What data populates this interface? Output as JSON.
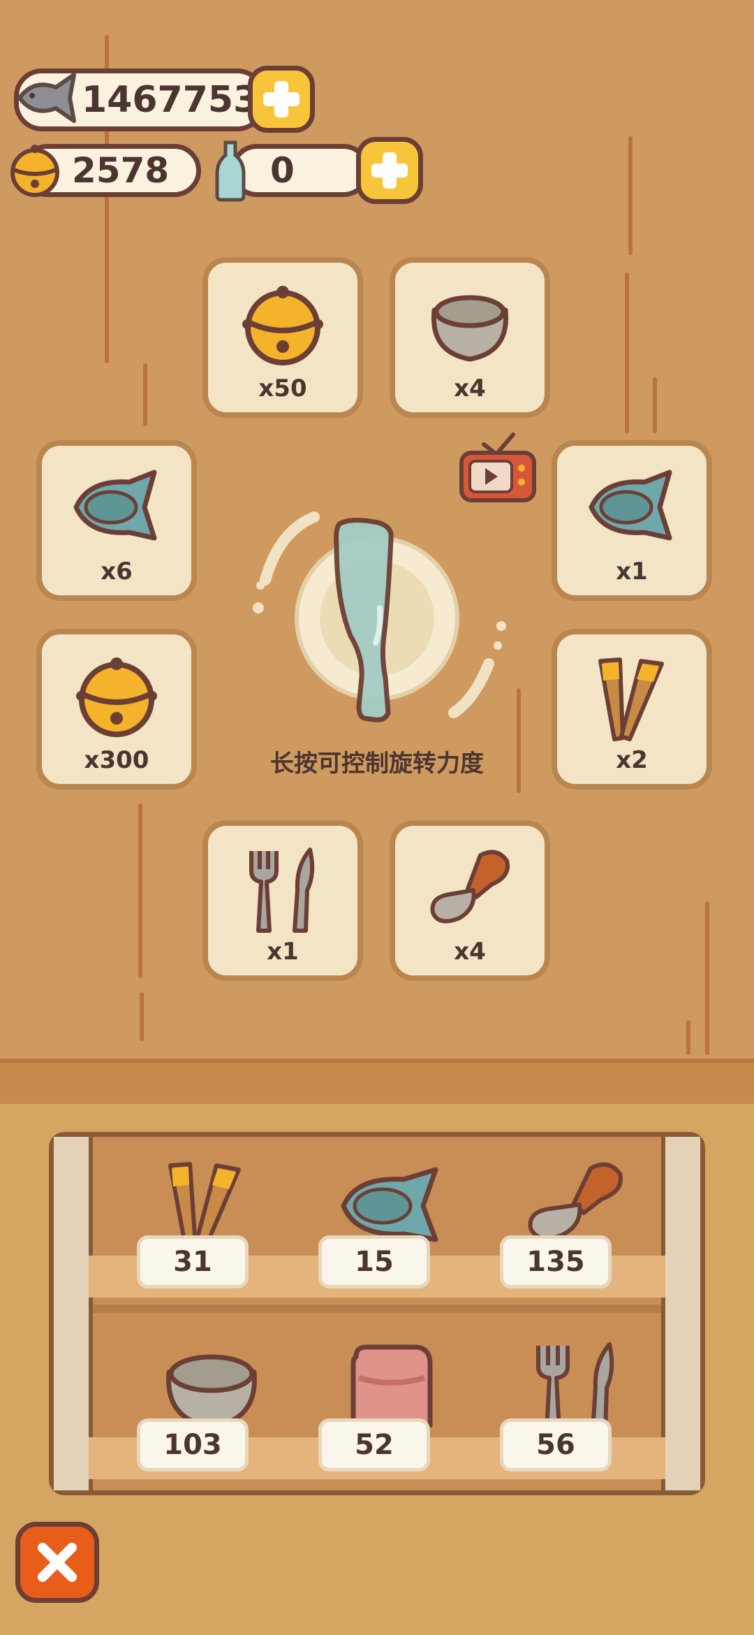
{
  "currency": {
    "fish": "1467753",
    "bells": "2578",
    "bottles": "0"
  },
  "rewards": [
    {
      "item": "bell-icon",
      "qty": "x50"
    },
    {
      "item": "bowl-icon",
      "qty": "x4"
    },
    {
      "item": "fish-plate-icon",
      "qty": "x6"
    },
    {
      "item": "fish-plate-icon",
      "qty": "x1"
    },
    {
      "item": "bell-icon",
      "qty": "x300"
    },
    {
      "item": "chopsticks-icon",
      "qty": "x2"
    },
    {
      "item": "cutlery-icon",
      "qty": "x1"
    },
    {
      "item": "ladle-icon",
      "qty": "x4"
    }
  ],
  "spinner": {
    "item": "bottle-icon",
    "hint": "长按可控制旋转力度"
  },
  "inventory": [
    {
      "item": "chopsticks-icon",
      "count": "31"
    },
    {
      "item": "fish-plate-icon",
      "count": "15"
    },
    {
      "item": "ladle-icon",
      "count": "135"
    },
    {
      "item": "bowl-icon",
      "count": "103"
    },
    {
      "item": "towel-icon",
      "count": "52"
    },
    {
      "item": "cutlery-icon",
      "count": "56"
    }
  ],
  "colors": {
    "wall": "#cf9a5f",
    "accent": "#f8c53a",
    "close": "#e85d1a"
  }
}
